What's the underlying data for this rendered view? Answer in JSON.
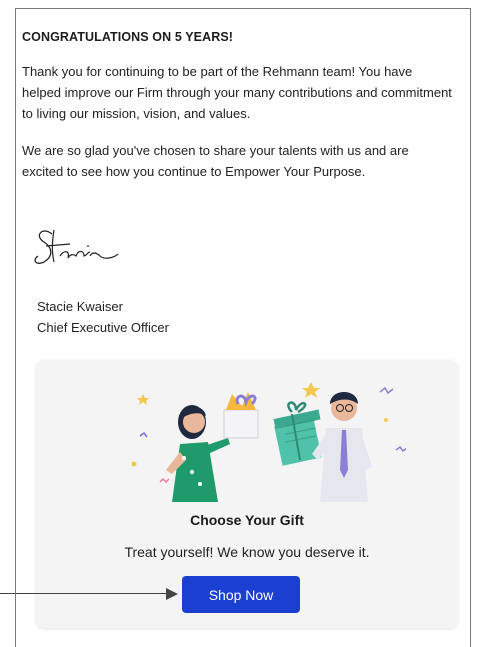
{
  "letter": {
    "heading": "CONGRATULATIONS ON 5 YEARS!",
    "paragraph1": "Thank you for continuing to be part of the Rehmann team! You have helped improve our Firm through your many contributions and commitment to living our mission, vision, and values.",
    "paragraph2": "We are so glad you've chosen to share your talents with us and are excited to see how you continue to Empower Your Purpose.",
    "signature_text": "Stacie",
    "signer_name": "Stacie Kwaiser",
    "signer_title": "Chief Executive Officer"
  },
  "gift_card": {
    "title": "Choose Your Gift",
    "subtitle": "Treat yourself! We know you deserve it.",
    "button_label": "Shop Now",
    "button_color": "#1a3fd1",
    "illustration_icon": "gift-exchange-illustration"
  }
}
